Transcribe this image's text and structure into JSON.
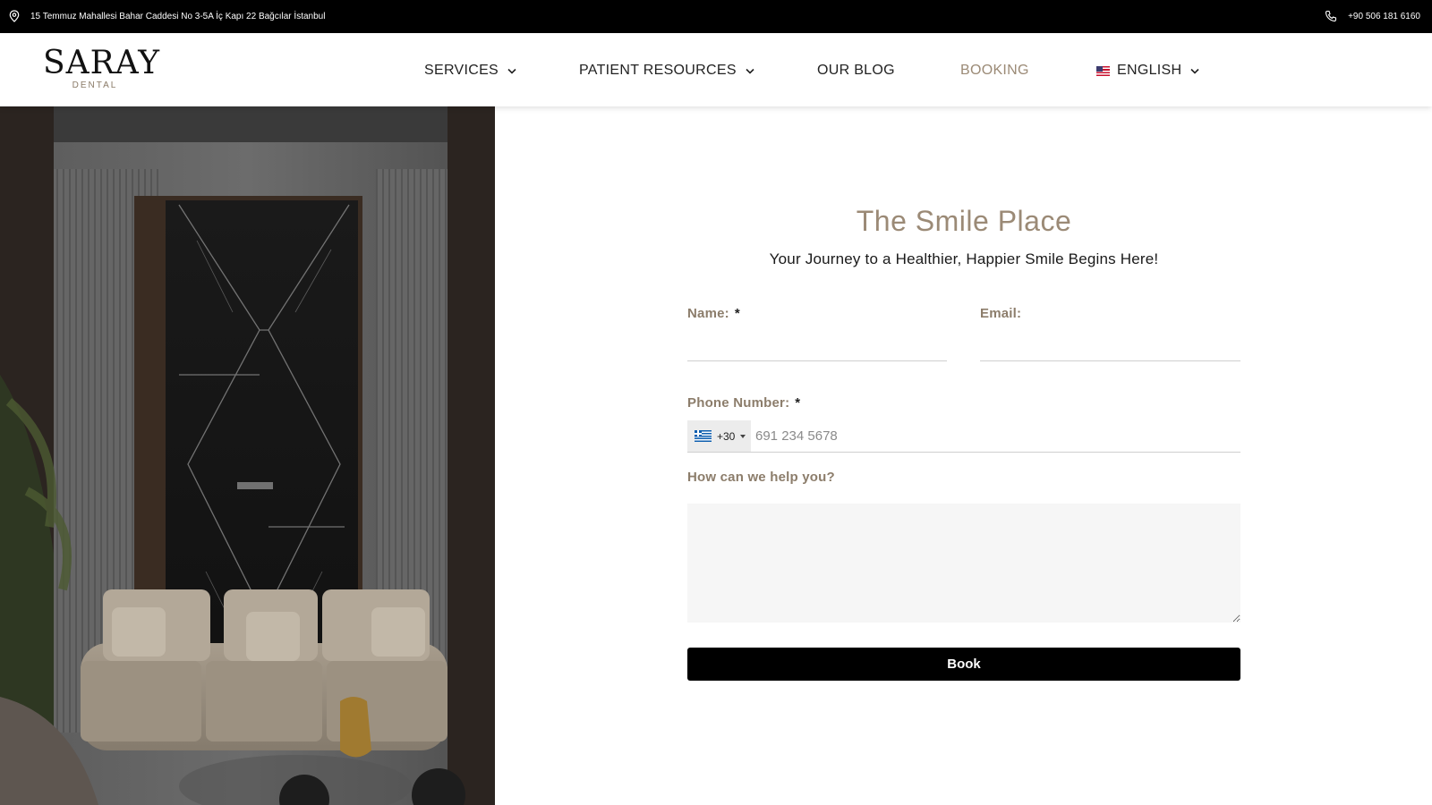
{
  "topbar": {
    "address": "15 Temmuz Mahallesi Bahar Caddesi No 3-5A İç Kapı 22 Bağcılar İstanbul",
    "phone": "+90 506 181 6160",
    "address_icon": "map-pin-icon",
    "phone_icon": "phone-icon"
  },
  "logo": {
    "brand": "SARAY",
    "sub": "DENTAL"
  },
  "nav": {
    "services": "SERVICES",
    "patient_resources": "PATIENT RESOURCES",
    "blog": "OUR BLOG",
    "booking": "BOOKING",
    "language": "ENGLISH"
  },
  "colors": {
    "accent": "#9b8a76",
    "topbar_bg": "#000000",
    "button_bg": "#000000"
  },
  "form": {
    "title": "The Smile Place",
    "subtitle": "Your Journey to a Healthier, Happier Smile Begins Here!",
    "name_label": "Name:",
    "email_label": "Email:",
    "required_mark": "*",
    "phone_label": "Phone Number:",
    "country_code": "+30",
    "phone_placeholder": "691 234 5678",
    "help_label": "How can we help you?",
    "submit_label": "Book"
  }
}
